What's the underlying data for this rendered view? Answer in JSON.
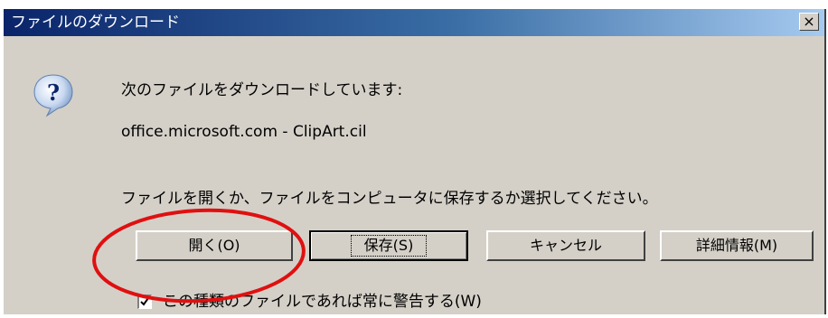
{
  "window": {
    "title": "ファイルのダウンロード",
    "close_label": "×"
  },
  "dialog": {
    "icon": "question-icon",
    "heading": "次のファイルをダウンロードしています:",
    "file_info": "office.microsoft.com - ClipArt.cil",
    "prompt": "ファイルを開くか、ファイルをコンピュータに保存するか選択してください。"
  },
  "buttons": {
    "open": "開く(O)",
    "save": "保存(S)",
    "cancel": "キャンセル",
    "more_info": "詳細情報(M)"
  },
  "checkbox": {
    "label": "この種類のファイルであれば常に警告する(W)",
    "checked": true
  },
  "colors": {
    "titlebar_start": "#0a246a",
    "titlebar_end": "#a6caf0",
    "dialog_bg": "#d4d0c8",
    "annotation": "#e01010"
  }
}
